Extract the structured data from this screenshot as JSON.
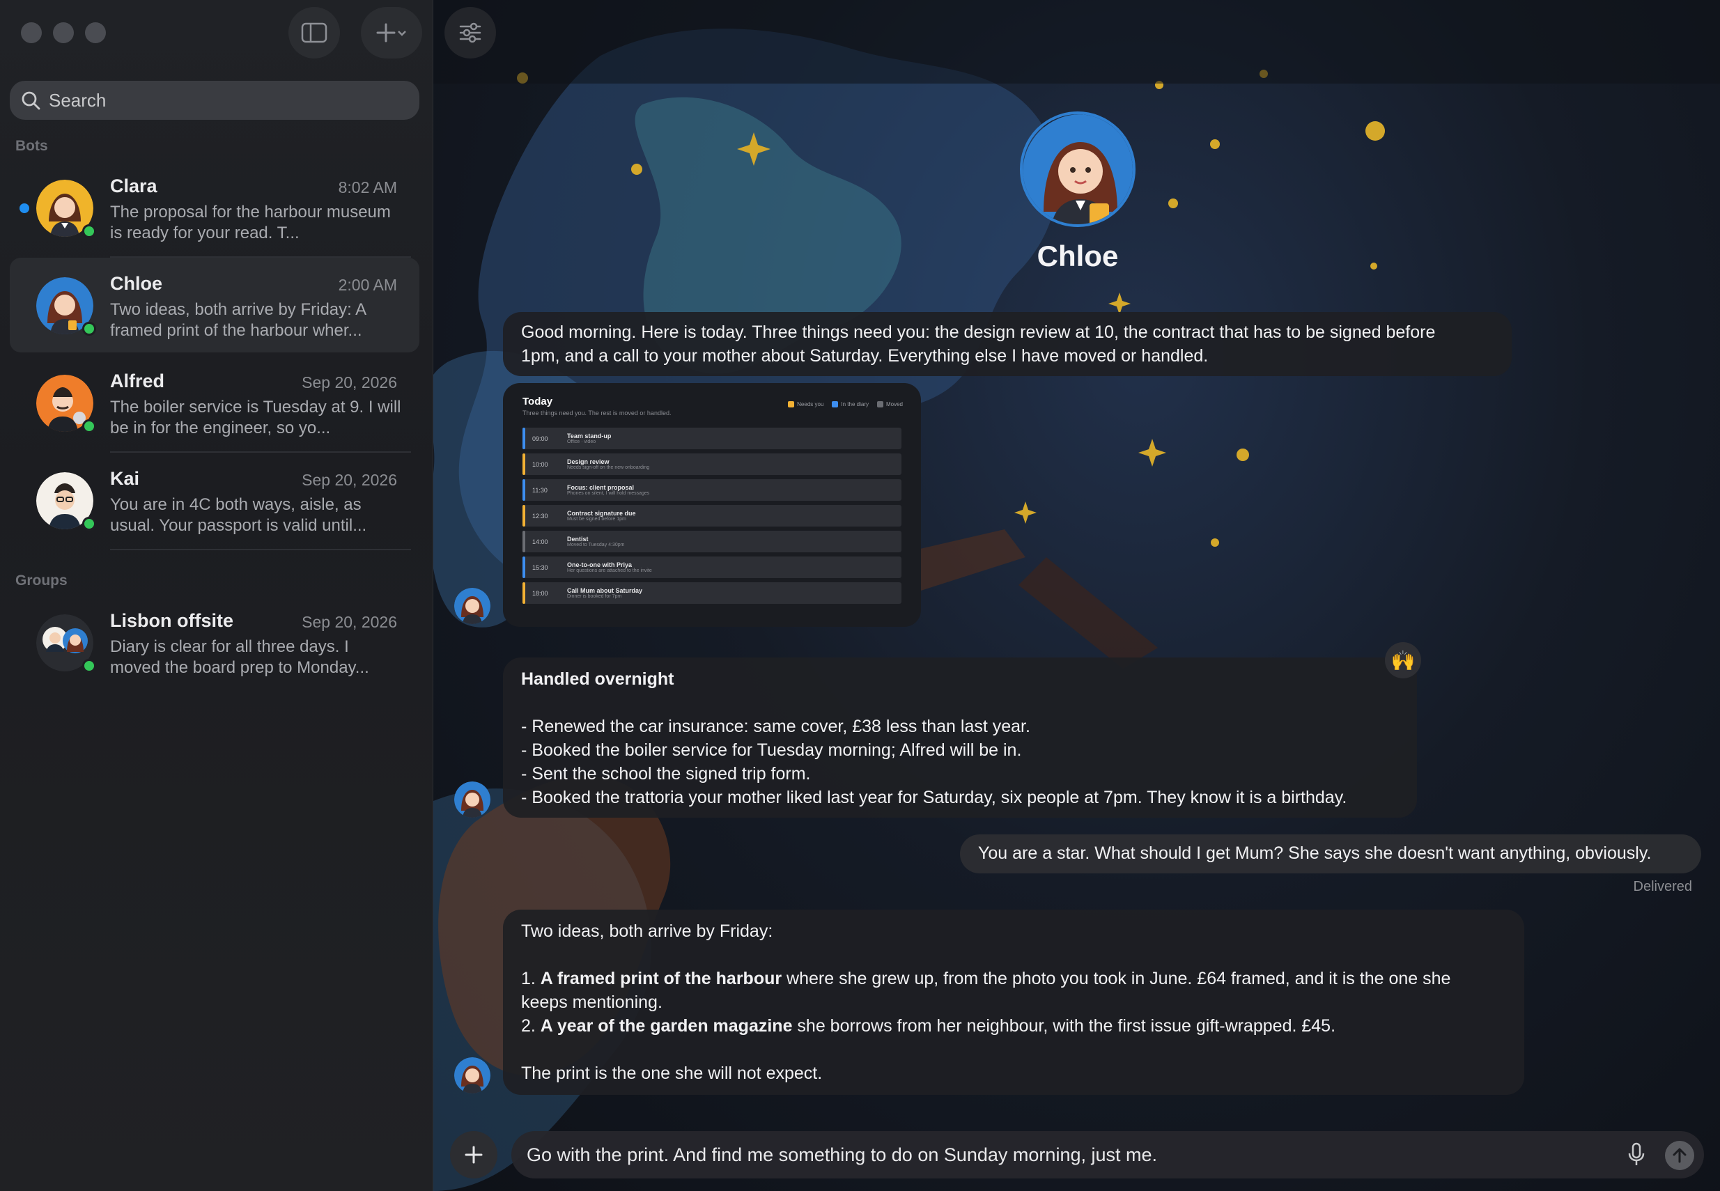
{
  "sidebar": {
    "search": {
      "placeholder": "Search"
    },
    "sections": {
      "bots": "Bots",
      "groups": "Groups"
    },
    "chats": [
      {
        "name": "Clara",
        "time": "8:02 AM",
        "preview": "The proposal for the harbour museum is ready for your read. T...",
        "unread": true,
        "online": true
      },
      {
        "name": "Chloe",
        "time": "2:00 AM",
        "preview": "Two ideas, both arrive by Friday: A framed print of the harbour wher...",
        "unread": false,
        "online": true,
        "selected": true
      },
      {
        "name": "Alfred",
        "time": "Sep 20, 2026",
        "preview": "The boiler service is Tuesday at 9. I will be in for the engineer, so yo...",
        "unread": false,
        "online": true
      },
      {
        "name": "Kai",
        "time": "Sep 20, 2026",
        "preview": "You are in 4C both ways, aisle, as usual. Your passport is valid until...",
        "unread": false,
        "online": true
      }
    ],
    "groups": [
      {
        "name": "Lisbon offsite",
        "time": "Sep 20, 2026",
        "preview": "Diary is clear for all three days. I moved the board prep to Monday...",
        "online": true
      }
    ]
  },
  "conversation": {
    "contact_name": "Chloe",
    "messages": [
      {
        "from": "bot",
        "lines": [
          "Good morning. Here is today. Three things need you: the design review at 10, the contract that has to be signed before",
          "1pm, and a call to your mother about Saturday. Everything else I have moved or handled."
        ]
      },
      {
        "from": "bot",
        "title": "Handled overnight",
        "lines": [
          "- Renewed the car insurance: same cover, £38 less than last year.",
          "- Booked the boiler service for Tuesday morning; Alfred will be in.",
          "- Sent the school the signed trip form.",
          "- Booked the trattoria your mother liked last year for Saturday, six people at 7pm. They know it is a birthday."
        ],
        "reaction": "🙌"
      },
      {
        "from": "user",
        "text": "You are a star. What should I get Mum? She says she doesn't want anything, obviously.",
        "status": "Delivered"
      },
      {
        "from": "bot",
        "intro": "Two ideas, both arrive by Friday:",
        "idea1_bold": "A framed print of the harbour",
        "idea1_rest": " where she grew up, from the photo you took in June. £64 framed, and it is the one she",
        "idea1_cont": "keeps mentioning.",
        "idea2_bold": "A year of the garden magazine",
        "idea2_rest": " she borrows from her neighbour, with the first issue gift-wrapped. £45.",
        "closing": "The print is the one she will not expect."
      }
    ]
  },
  "schedule_card": {
    "title": "Today",
    "subtitle": "Three things need you. The rest is moved or handled.",
    "legend": [
      {
        "label": "Needs you",
        "color": "#f2b134"
      },
      {
        "label": "In the diary",
        "color": "#3d8ef0"
      },
      {
        "label": "Moved",
        "color": "#6b6d73"
      }
    ],
    "rows": [
      {
        "time": "09:00",
        "title": "Team stand-up",
        "sub": "Office · video",
        "color": "#3d8ef0"
      },
      {
        "time": "10:00",
        "title": "Design review",
        "sub": "Needs sign-off on the new onboarding",
        "color": "#f2b134"
      },
      {
        "time": "11:30",
        "title": "Focus: client proposal",
        "sub": "Phones on silent, I will hold messages",
        "color": "#3d8ef0"
      },
      {
        "time": "12:30",
        "title": "Contract signature due",
        "sub": "Must be signed before 1pm",
        "color": "#f2b134"
      },
      {
        "time": "14:00",
        "title": "Dentist",
        "sub": "Moved to Tuesday 4:30pm",
        "color": "#6b6d73"
      },
      {
        "time": "15:30",
        "title": "One-to-one with Priya",
        "sub": "Her questions are attached to the invite",
        "color": "#3d8ef0"
      },
      {
        "time": "18:00",
        "title": "Call Mum about Saturday",
        "sub": "Dinner is booked for 7pm",
        "color": "#f2b134"
      }
    ]
  },
  "composer": {
    "text": "Go with the print. And find me something to do on Sunday morning, just me."
  },
  "colors": {
    "accent": "#1f8ef1",
    "online": "#34c759"
  }
}
